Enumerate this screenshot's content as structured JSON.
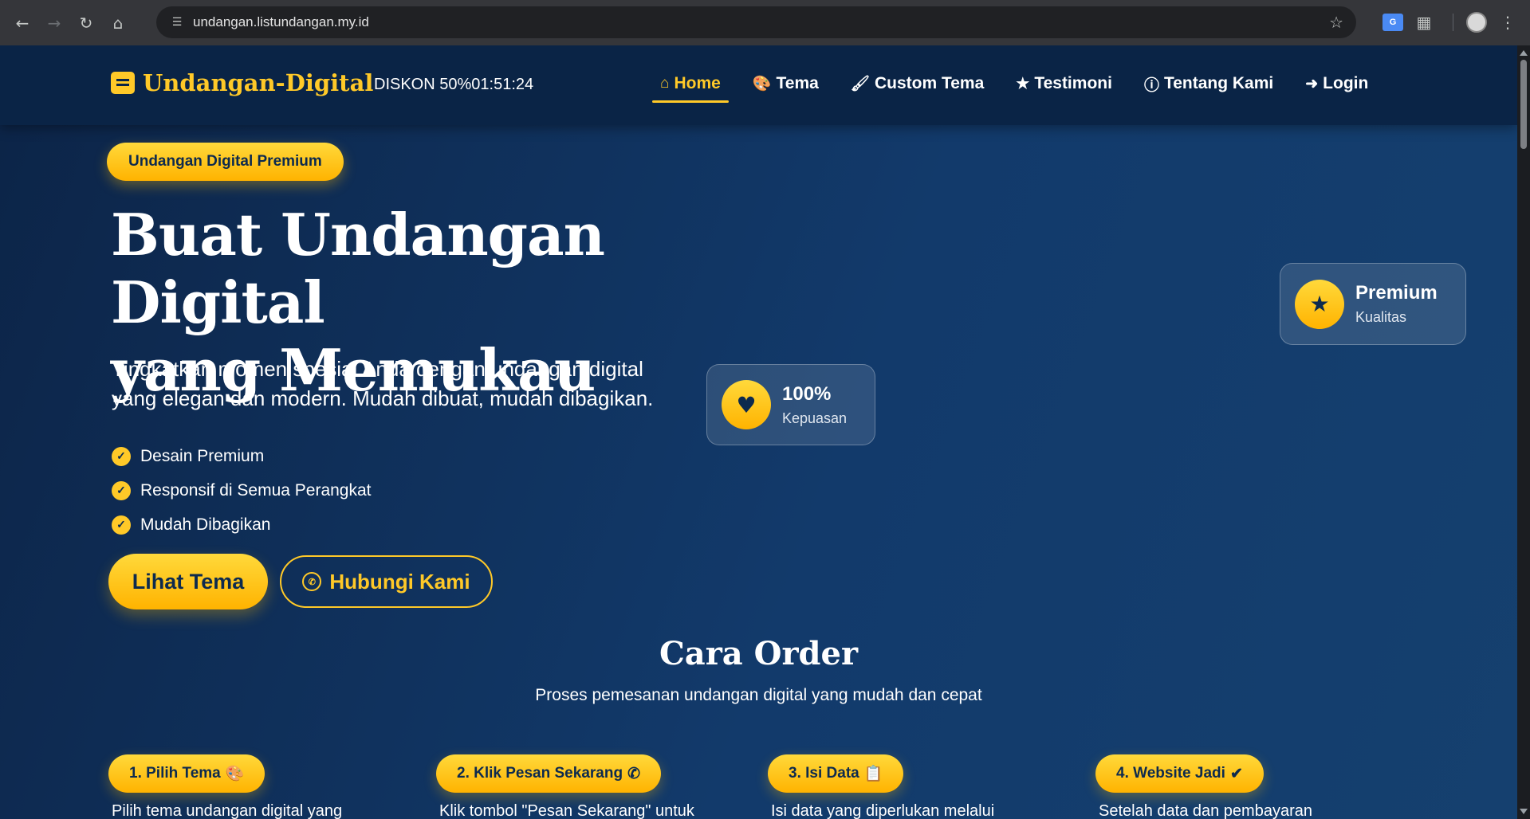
{
  "browser": {
    "url": "undangan.listundangan.my.id",
    "translate_label": "G"
  },
  "navbar": {
    "brand": "Undangan-Digital",
    "discount": "DISKON 50%01:51:24",
    "items": [
      {
        "label": "Home",
        "icon": "home-icon"
      },
      {
        "label": "Tema",
        "icon": "palette-icon"
      },
      {
        "label": "Custom Tema",
        "icon": "brush-icon"
      },
      {
        "label": "Testimoni",
        "icon": "star-icon"
      },
      {
        "label": "Tentang Kami",
        "icon": "info-icon"
      },
      {
        "label": "Login",
        "icon": "login-icon"
      }
    ]
  },
  "hero": {
    "badge": "Undangan Digital Premium",
    "title_line1": "Buat Undangan Digital",
    "title_line2": "yang Memukau",
    "subtitle_line1": "Tingkatkan momen spesial Anda dengan undangan digital",
    "subtitle_line2": "yang elegan dan modern. Mudah dibuat, mudah dibagikan.",
    "features": [
      "Desain Premium",
      "Responsif di Semua Perangkat",
      "Mudah Dibagikan"
    ],
    "btn_primary": "Lihat Tema",
    "btn_secondary": "Hubungi Kami"
  },
  "stats": [
    {
      "value": "100%",
      "label": "Kepuasan",
      "icon": "heart-icon"
    },
    {
      "value": "Premium",
      "label": "Kualitas",
      "icon": "star-icon"
    }
  ],
  "order": {
    "title": "Cara Order",
    "subtitle": "Proses pemesanan undangan digital yang mudah dan cepat",
    "steps": [
      {
        "label": "1. Pilih Tema",
        "icon": "palette-icon",
        "desc": "Pilih tema undangan digital yang"
      },
      {
        "label": "2. Klik Pesan Sekarang",
        "icon": "whatsapp-icon",
        "desc": "Klik tombol \"Pesan Sekarang\" untuk"
      },
      {
        "label": "3. Isi Data",
        "icon": "clipboard-icon",
        "desc": "Isi data yang diperlukan melalui"
      },
      {
        "label": "4. Website Jadi",
        "icon": "check-circle-icon",
        "desc": "Setelah data dan pembayaran"
      }
    ]
  },
  "colors": {
    "accent": "#ffc928",
    "background": "#0d2a4e",
    "text": "#ffffff"
  }
}
